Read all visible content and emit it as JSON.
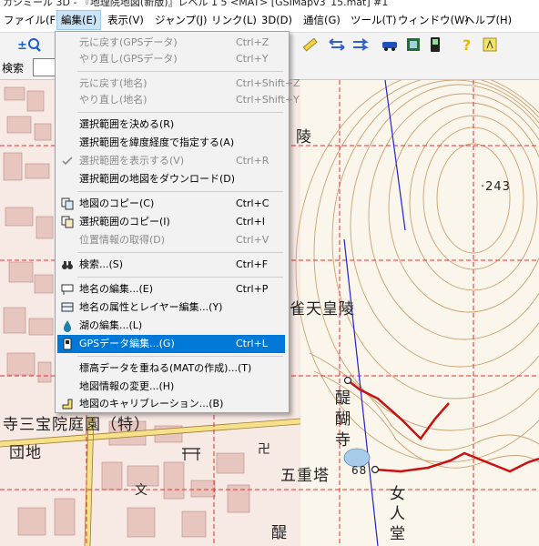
{
  "title": "カシミール 3D - 『地理院地図(新版)』レベル 1 5 <MAT> [GSIMapv3_15.mat] #1",
  "menubar": [
    {
      "label": "ファイル(F)"
    },
    {
      "label": "編集(E)"
    },
    {
      "label": "表示(V)"
    },
    {
      "label": "ジャンプ(J)"
    },
    {
      "label": "リンク(L)"
    },
    {
      "label": "3D(D)"
    },
    {
      "label": "通信(G)"
    },
    {
      "label": "ツール(T)"
    },
    {
      "label": "ウィンドウ(W)"
    },
    {
      "label": "ヘルプ(H)"
    }
  ],
  "search": {
    "label": "検索",
    "value": ""
  },
  "edit_menu": {
    "items": [
      {
        "label": "元に戻す(GPSデータ)",
        "shortcut": "Ctrl+Z",
        "disabled": true
      },
      {
        "label": "やり直し(GPSデータ)",
        "shortcut": "Ctrl+Y",
        "disabled": true
      },
      {
        "label": "元に戻す(地名)",
        "shortcut": "Ctrl+Shift+Z",
        "disabled": true
      },
      {
        "label": "やり直し(地名)",
        "shortcut": "Ctrl+Shift+Y",
        "disabled": true
      },
      {
        "label": "選択範囲を決める(R)",
        "shortcut": ""
      },
      {
        "label": "選択範囲を緯度経度で指定する(A)",
        "shortcut": ""
      },
      {
        "label": "選択範囲を表示する(V)",
        "shortcut": "Ctrl+R",
        "disabled": true,
        "checked": true
      },
      {
        "label": "選択範囲の地図をダウンロード(D)",
        "shortcut": ""
      },
      {
        "label": "地図のコピー(C)",
        "shortcut": "Ctrl+C",
        "icon": "copy-map-icon"
      },
      {
        "label": "選択範囲のコピー(I)",
        "shortcut": "Ctrl+I",
        "icon": "copy-selection-icon"
      },
      {
        "label": "位置情報の取得(D)",
        "shortcut": "Ctrl+V",
        "disabled": true
      },
      {
        "label": "検索...(S)",
        "shortcut": "Ctrl+F",
        "icon": "binoculars-icon"
      },
      {
        "label": "地名の編集...(E)",
        "shortcut": "Ctrl+P",
        "icon": "place-name-icon"
      },
      {
        "label": "地名の属性とレイヤー編集...(Y)",
        "shortcut": "",
        "icon": "layer-icon"
      },
      {
        "label": "湖の編集...(L)",
        "shortcut": "",
        "icon": "lake-icon"
      },
      {
        "label": "GPSデータ編集...(G)",
        "shortcut": "Ctrl+L",
        "highlight": true,
        "icon": "gps-icon"
      },
      {
        "label": "標高データを重ねる(MATの作成)...(T)",
        "shortcut": ""
      },
      {
        "label": "地図情報の変更...(H)",
        "shortcut": ""
      },
      {
        "label": "地図のキャリブレーション...(B)",
        "shortcut": "",
        "icon": "calibration-icon"
      }
    ]
  },
  "map": {
    "labels": [
      {
        "text": "陵"
      },
      {
        "text": "雀天皇陵"
      },
      {
        "text": "醍"
      },
      {
        "text": "醐"
      },
      {
        "text": "寺"
      },
      {
        "text": "寺三宝院庭園（特）"
      },
      {
        "text": "団地"
      },
      {
        "text": "五重塔"
      },
      {
        "text": "女"
      },
      {
        "text": "人"
      },
      {
        "text": "堂"
      },
      {
        "text": "醍"
      },
      {
        "text": "文"
      },
      {
        "text": "卍"
      }
    ],
    "spot_heights": [
      {
        "text": "243"
      },
      {
        "text": "68"
      }
    ]
  },
  "colors": {
    "menu_highlight": "#0078d7",
    "grid_red": "#e03030",
    "route_red": "#cc1010",
    "line_blue": "#2222cc",
    "road_yellow": "#f6e08a",
    "contour": "#c9a070"
  }
}
